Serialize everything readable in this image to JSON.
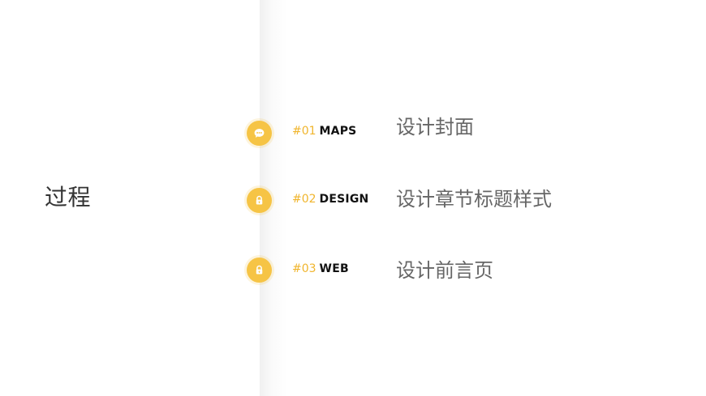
{
  "left": {
    "title": "过程"
  },
  "items": [
    {
      "num": "#01",
      "label": "MAPS",
      "desc": "设计封面",
      "icon": "chat-bubble-icon"
    },
    {
      "num": "#02",
      "label": "DESIGN",
      "desc": "设计章节标题样式",
      "icon": "lock-icon"
    },
    {
      "num": "#03",
      "label": "WEB",
      "desc": "设计前言页",
      "icon": "lock-icon"
    }
  ],
  "colors": {
    "accent": "#f6c445",
    "accent_text": "#f0b52d",
    "title_text": "#333333",
    "desc_text": "#666666",
    "label_text": "#111111",
    "background": "#ffffff",
    "stripe": "#fdfbf3"
  }
}
